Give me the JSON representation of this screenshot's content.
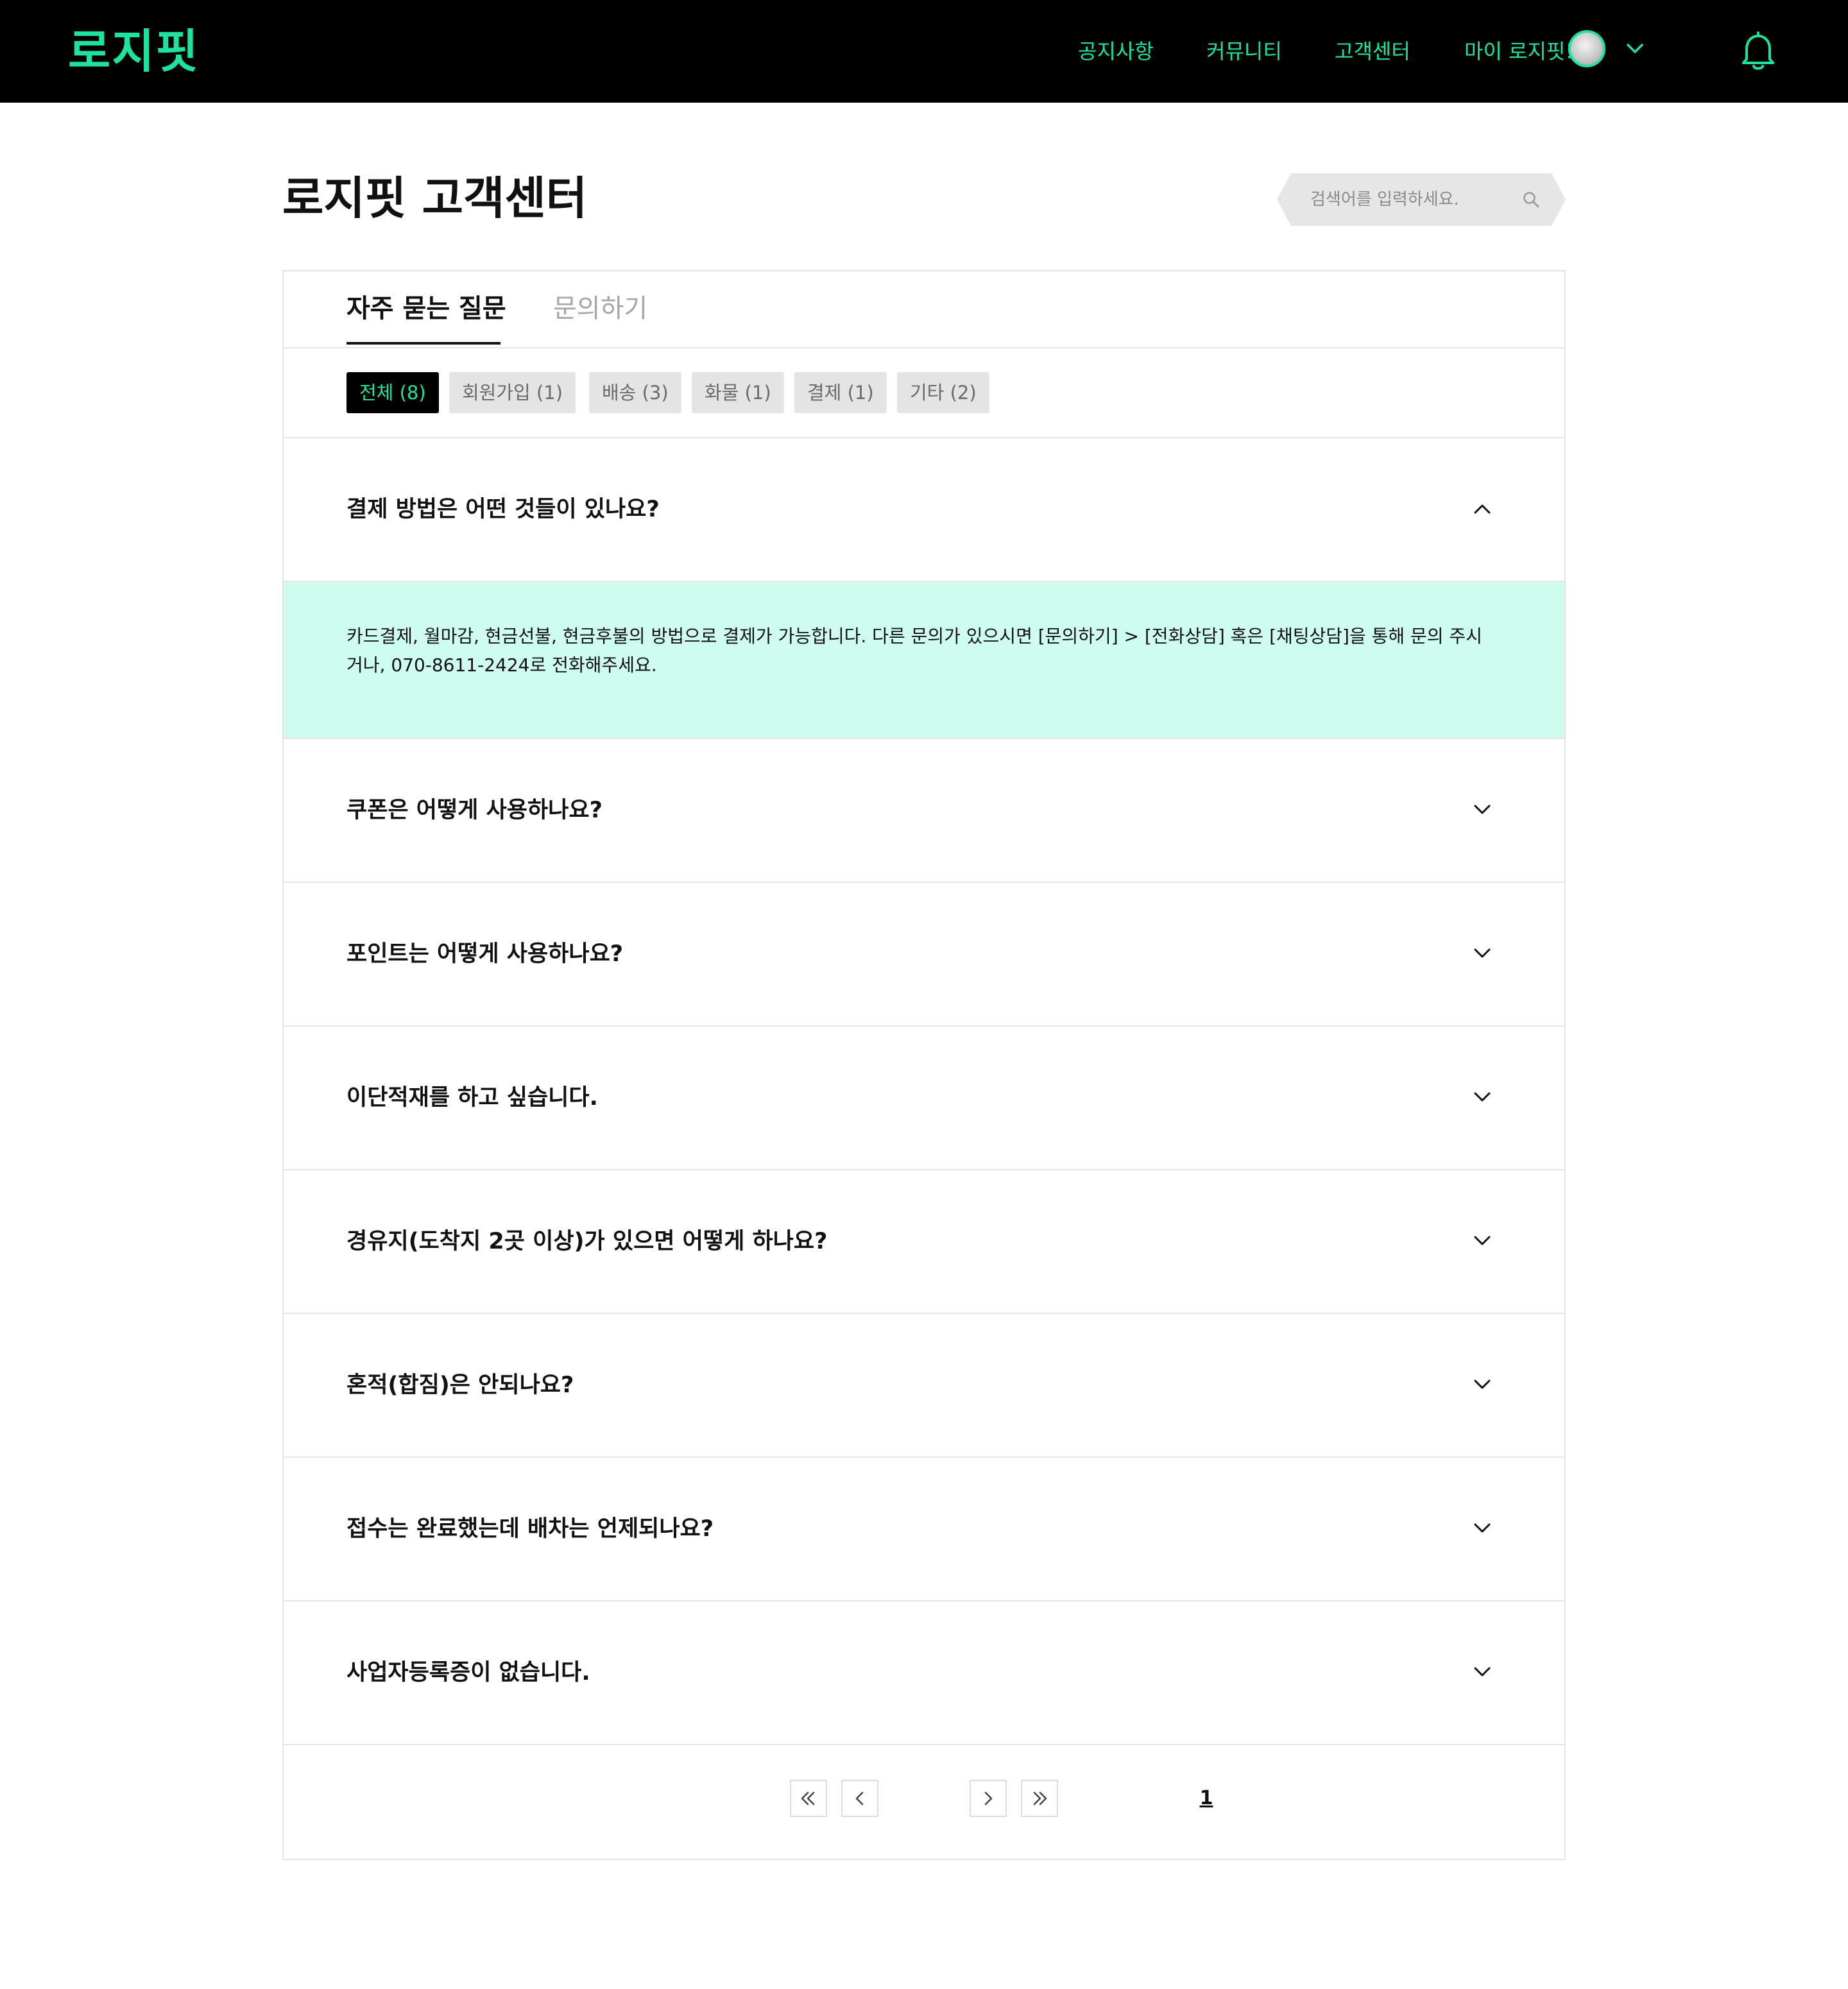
{
  "brand": {
    "logo_text": "로지핏",
    "accent_color": "#1de2a0",
    "header_bg": "#000000"
  },
  "nav": {
    "items": [
      {
        "label": "공지사항"
      },
      {
        "label": "커뮤니티"
      },
      {
        "label": "고객센터"
      },
      {
        "label": "마이 로지핏!"
      }
    ],
    "avatar": "user-avatar",
    "dropdown_icon": "chevron-down-icon",
    "notification_icon": "bell-icon"
  },
  "page": {
    "title": "로지핏 고객센터"
  },
  "search": {
    "placeholder": "검색어를 입력하세요.",
    "value": "",
    "icon": "search-icon"
  },
  "tabs": [
    {
      "label": "자주 묻는 질문",
      "active": true
    },
    {
      "label": "문의하기",
      "active": false
    }
  ],
  "categories": [
    {
      "label": "전체 (8)",
      "active": true
    },
    {
      "label": "회원가입 (1)",
      "active": false
    },
    {
      "label": "배송 (3)",
      "active": false
    },
    {
      "label": "화물 (1)",
      "active": false
    },
    {
      "label": "결제 (1)",
      "active": false
    },
    {
      "label": "기타 (2)",
      "active": false
    }
  ],
  "faq": [
    {
      "question": "결제 방법은 어떤 것들이 있나요?",
      "expanded": true,
      "answer": "카드결제, 월마감, 현금선불, 현금후불의 방법으로 결제가 가능합니다. 다른 문의가 있으시면 [문의하기] > [전화상담] 혹은 [채팅상담]을 통해 문의 주시거나, 070-8611-2424로 전화해주세요."
    },
    {
      "question": "쿠폰은 어떻게 사용하나요?",
      "expanded": false
    },
    {
      "question": "포인트는 어떻게 사용하나요?",
      "expanded": false
    },
    {
      "question": "이단적재를 하고 싶습니다.",
      "expanded": false
    },
    {
      "question": "경유지(도착지 2곳 이상)가 있으면 어떻게 하나요?",
      "expanded": false
    },
    {
      "question": "혼적(합짐)은 안되나요?",
      "expanded": false
    },
    {
      "question": "접수는 완료했는데 배차는 언제되나요?",
      "expanded": false
    },
    {
      "question": "사업자등록증이 없습니다.",
      "expanded": false
    }
  ],
  "answer_bg_color": "#cefcee",
  "pagination": {
    "current_page": "1",
    "first_icon": "double-chevron-left-icon",
    "prev_icon": "chevron-left-icon",
    "next_icon": "chevron-right-icon",
    "last_icon": "double-chevron-right-icon"
  }
}
